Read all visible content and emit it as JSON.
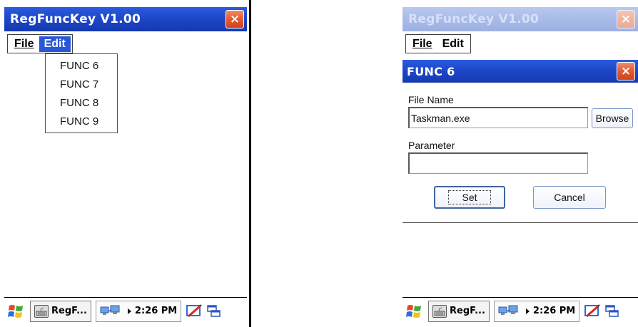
{
  "left_screen": {
    "title": "RegFuncKey  V1.00",
    "close_glyph": "×",
    "menu": {
      "file": "File",
      "edit": "Edit"
    },
    "edit_dropdown": [
      "FUNC 6",
      "FUNC 7",
      "FUNC 8",
      "FUNC 9"
    ],
    "taskbar": {
      "app_label": "RegF...",
      "clock": "2:26 PM"
    }
  },
  "right_screen": {
    "title": "RegFuncKey  V1.00",
    "close_glyph": "×",
    "menu": {
      "file": "File",
      "edit": "Edit"
    },
    "dialog": {
      "title": "FUNC 6",
      "close_glyph": "×",
      "file_name_label": "File Name",
      "file_name_value": "Taskman.exe",
      "browse_label": "Browse",
      "parameter_label": "Parameter",
      "parameter_value": "",
      "set_label": "Set",
      "cancel_label": "Cancel"
    },
    "taskbar": {
      "app_label": "RegF...",
      "clock": "2:26 PM"
    }
  },
  "icons": [
    "windows-start-icon",
    "keyboard-app-icon",
    "network-icon",
    "pen-input-icon",
    "task-switch-icon",
    "close-icon"
  ],
  "colors": {
    "titlebar_active": "#1e48c8",
    "titlebar_inactive": "#a8bbe9",
    "menu_highlight": "#2957d8",
    "close_button": "#e45a30"
  }
}
